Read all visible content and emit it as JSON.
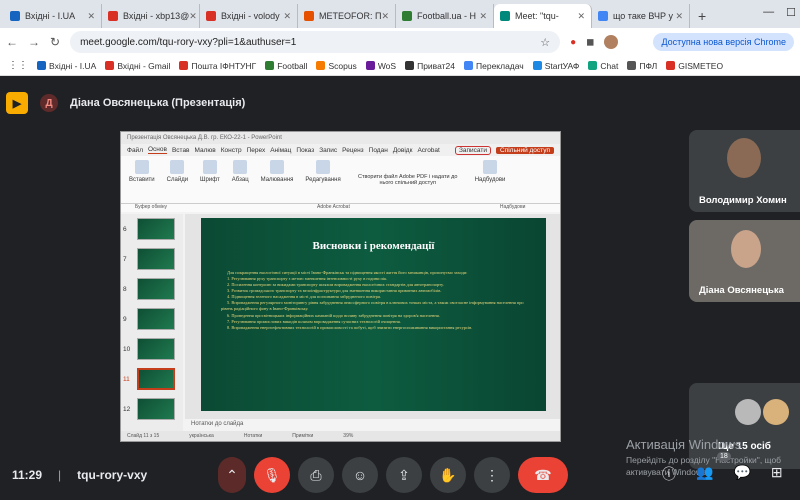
{
  "tabs": [
    {
      "label": "Вхідні - I.UA",
      "color": "#1565c0"
    },
    {
      "label": "Вхідні - xbp13@",
      "color": "#d93025"
    },
    {
      "label": "Вхідні - volody",
      "color": "#d93025"
    },
    {
      "label": "METEOFOR: П",
      "color": "#e65100"
    },
    {
      "label": "Football.ua - Н",
      "color": "#2e7d32"
    },
    {
      "label": "Meet: \"tqu-",
      "color": "#00897b"
    },
    {
      "label": "що таке ВЧР у",
      "color": "#4285f4"
    }
  ],
  "address": {
    "url": "meet.google.com/tqu-rory-vxy?pli=1&authuser=1",
    "update_label": "Доступна нова версія Chrome"
  },
  "bookmarks": [
    {
      "label": "Вхідні - I.UA",
      "color": "#1565c0"
    },
    {
      "label": "Вхідні - Gmail",
      "color": "#d93025"
    },
    {
      "label": "Пошта ІФНТУНГ",
      "color": "#d93025"
    },
    {
      "label": "Football",
      "color": "#2e7d32"
    },
    {
      "label": "Scopus",
      "color": "#f57c00"
    },
    {
      "label": "WoS",
      "color": "#6a1b9a"
    },
    {
      "label": "Приват24",
      "color": "#333333"
    },
    {
      "label": "Перекладач",
      "color": "#4285f4"
    },
    {
      "label": "StartУАФ",
      "color": "#1e88e5"
    },
    {
      "label": "Chat",
      "color": "#10a37f"
    },
    {
      "label": "ПФЛ",
      "color": "#555555"
    },
    {
      "label": "GISMETEO",
      "color": "#d93025"
    }
  ],
  "presenter": {
    "initial": "Д",
    "title": "Діана Овсянецька (Презентація)"
  },
  "ppt": {
    "window_title": "Презентація Овсянецька Д.В. гр. ЕКО-22-1 - PowerPoint",
    "menu": [
      "Файл",
      "Основ",
      "Встав",
      "Малюв",
      "Констр",
      "Перех",
      "Анімац",
      "Показ",
      "Запис",
      "Реценз",
      "Подан",
      "Довідк",
      "Acrobat"
    ],
    "record_label": "Записати",
    "share_label": "Спільний доступ",
    "ribbon": [
      "Вставити",
      "Слайди",
      "Шрифт",
      "Абзац",
      "Малювання",
      "Редагування"
    ],
    "adobe_label": "Створити файл Adobe PDF і надати до нього спільний доступ",
    "addins_label": "Надбудови",
    "ribbon_sub": [
      "Буфер обміну",
      "Adobe Acrobat",
      "Надбудови"
    ],
    "thumb_numbers": [
      "6",
      "7",
      "8",
      "9",
      "10",
      "11",
      "12"
    ],
    "selected_slide": "11",
    "slide_title": "Висновки і рекомендації",
    "slide_intro": "Для покращення екологічної ситуації в місті Івано-Франківськ та підвищення якості життя його мешканців, пропонуємо заходи:",
    "slide_items": [
      "1. Регулювання руху транспорту з метою зменшення інтенсивності руху в години пік.",
      "2. Посилення контролю за викидами транспорту шляхом впровадження екологічних стандартів для автотранспорту.",
      "3. Розвиток громадського транспорту та велоінфраструктури для зменшення використання приватних автомобілів.",
      "4. Підвищення зеленого насадження в місті для поглинання забрудненого повітря.",
      "5. Впровадження регулярного моніторингу рівня забруднення атмосферного повітря в ключових точках міста, а також своєчасне інформування населення про рівень радіаційного фону в Івано-Франківську.",
      "6. Проведення просвітницьких інформаційних кампаній щодо впливу забруднення повітря на здоров'я населення.",
      "7. Регулювання промислових викидів шляхом впровадження сучасних технологій очищення.",
      "8. Впровадження енергоефективних технологій в промисловості та побуті, щоб знизити енергоспоживання використання ресурсів."
    ],
    "notes_label": "Нотатки до слайда",
    "status": [
      "Слайд 11 з 15",
      "українська",
      "Нотатки",
      "Примітки",
      "39%"
    ]
  },
  "participants": [
    {
      "name": "Володимир Хомин"
    },
    {
      "name": "Діана Овсянецька"
    }
  ],
  "others_count": "Ще 15 осіб",
  "watermark": {
    "title": "Активація Windows",
    "text": "Перейдіть до розділу \"Настройки\", щоб активувати Windows."
  },
  "bottom": {
    "time": "11:29",
    "meeting_code": "tqu-rory-vxy",
    "participants_badge": "18"
  }
}
